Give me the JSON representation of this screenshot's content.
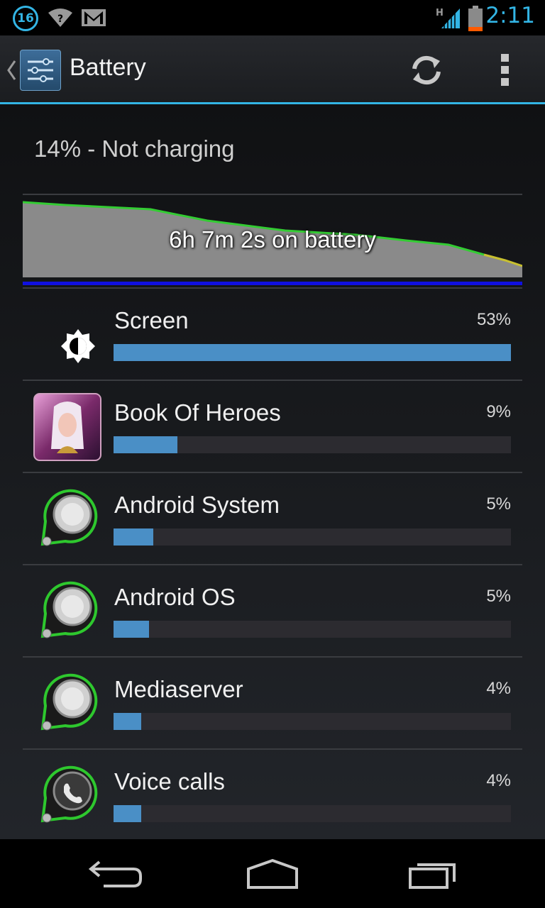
{
  "status_bar": {
    "notification_count": "16",
    "network_type": "H",
    "clock": "2:11",
    "icons": [
      "notification-count-icon",
      "wifi-question-icon",
      "gmail-icon",
      "signal-icon",
      "battery-icon"
    ],
    "accent_color": "#33b5e5"
  },
  "action_bar": {
    "title": "Battery",
    "icons": [
      "settings-icon",
      "refresh-icon",
      "overflow-menu-icon"
    ]
  },
  "battery_status": "14% - Not charging",
  "graph": {
    "label": "6h 7m 2s on battery",
    "line_color": "#33cc33",
    "fill_color": "#8a8a8a",
    "baseline_color": "#1010e0"
  },
  "usage": [
    {
      "label": "Screen",
      "percent_text": "53%",
      "fraction": 1.0,
      "icon": "brightness-icon"
    },
    {
      "label": "Book Of Heroes",
      "percent_text": "9%",
      "fraction": 0.16,
      "icon": "book-of-heroes-app-icon"
    },
    {
      "label": "Android System",
      "percent_text": "5%",
      "fraction": 0.1,
      "icon": "android-system-icon"
    },
    {
      "label": "Android OS",
      "percent_text": "5%",
      "fraction": 0.09,
      "icon": "android-os-icon"
    },
    {
      "label": "Mediaserver",
      "percent_text": "4%",
      "fraction": 0.07,
      "icon": "mediaserver-icon"
    },
    {
      "label": "Voice calls",
      "percent_text": "4%",
      "fraction": 0.07,
      "icon": "phone-icon"
    }
  ],
  "bar_color": "#4a8fc6",
  "nav": [
    "back-icon",
    "home-icon",
    "recent-apps-icon"
  ]
}
